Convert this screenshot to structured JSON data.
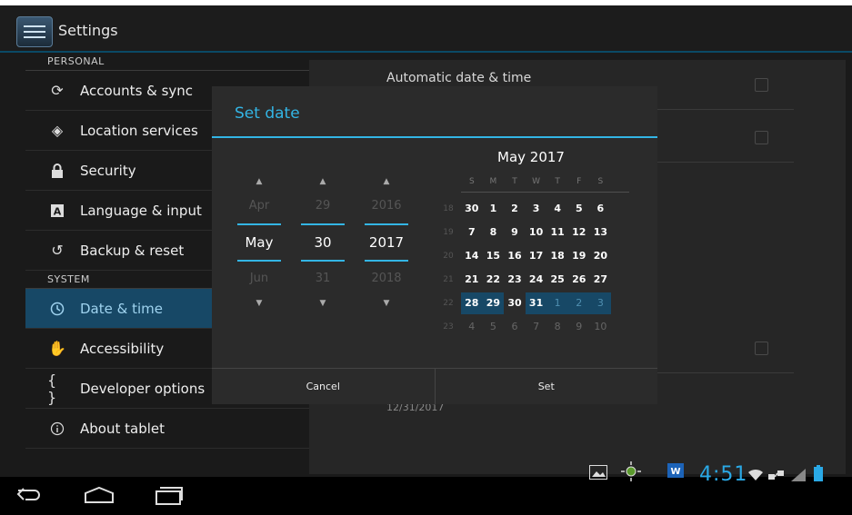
{
  "app": {
    "title": "Settings"
  },
  "sidebar": {
    "personal_header": "PERSONAL",
    "personal_items": [
      {
        "label": "Accounts & sync",
        "icon": "sync-icon"
      },
      {
        "label": "Location services",
        "icon": "location-icon"
      },
      {
        "label": "Security",
        "icon": "lock-icon"
      },
      {
        "label": "Language & input",
        "icon": "keyboard-icon"
      },
      {
        "label": "Backup & reset",
        "icon": "backup-icon"
      }
    ],
    "system_header": "SYSTEM",
    "system_items": [
      {
        "label": "Date & time",
        "icon": "clock-icon",
        "selected": true
      },
      {
        "label": "Accessibility",
        "icon": "hand-icon"
      },
      {
        "label": "Developer options",
        "icon": "braces-icon"
      },
      {
        "label": "About tablet",
        "icon": "info-icon"
      }
    ]
  },
  "main": {
    "automatic_label": "Automatic date & time",
    "date_sub": "12/31/2017"
  },
  "dialog": {
    "title": "Set date",
    "month": {
      "prev": "Apr",
      "cur": "May",
      "next": "Jun"
    },
    "day": {
      "prev": "29",
      "cur": "30",
      "next": "31"
    },
    "year": {
      "prev": "2016",
      "cur": "2017",
      "next": "2018"
    },
    "calendar": {
      "title": "May 2017",
      "weekdays": [
        "S",
        "M",
        "T",
        "W",
        "T",
        "F",
        "S"
      ],
      "weeks": [
        {
          "num": "18",
          "days": [
            "30",
            "1",
            "2",
            "3",
            "4",
            "5",
            "6"
          ]
        },
        {
          "num": "19",
          "days": [
            "7",
            "8",
            "9",
            "10",
            "11",
            "12",
            "13"
          ]
        },
        {
          "num": "20",
          "days": [
            "14",
            "15",
            "16",
            "17",
            "18",
            "19",
            "20"
          ]
        },
        {
          "num": "21",
          "days": [
            "21",
            "22",
            "23",
            "24",
            "25",
            "26",
            "27"
          ]
        },
        {
          "num": "22",
          "days": [
            "28",
            "29",
            "30",
            "31",
            "1",
            "2",
            "3"
          ]
        },
        {
          "num": "23",
          "days": [
            "4",
            "5",
            "6",
            "7",
            "8",
            "9",
            "10"
          ]
        }
      ]
    },
    "cancel_label": "Cancel",
    "set_label": "Set"
  },
  "statusbar": {
    "time": "4:51"
  },
  "colors": {
    "accent": "#33b5e5",
    "selected_bg": "#174866"
  }
}
